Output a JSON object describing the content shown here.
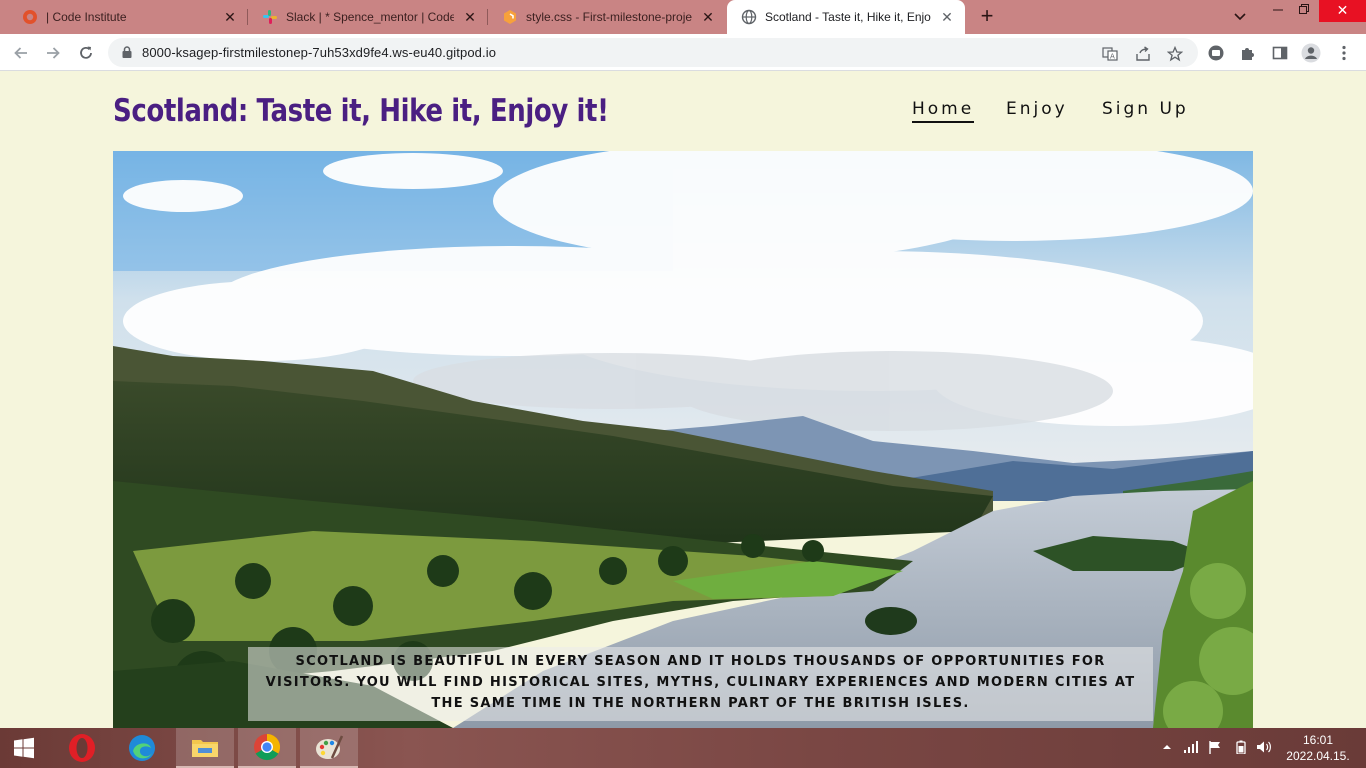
{
  "browser": {
    "tabs": [
      {
        "title": "| Code Institute",
        "icon": "code-institute-icon"
      },
      {
        "title": "Slack | * Spence_mentor | Code Ir",
        "icon": "slack-icon"
      },
      {
        "title": "style.css - First-milestone-project",
        "icon": "gitpod-icon"
      },
      {
        "title": "Scotland - Taste it, Hike it, Enjoy it",
        "icon": "globe-icon",
        "active": true
      }
    ],
    "new_tab_label": "+",
    "url": "8000-ksagep-firstmilestonep-7uh53xd9fe4.ws-eu40.gitpod.io"
  },
  "site": {
    "title": "Scotland: Taste it, Hike it, Enjoy it!",
    "nav": [
      "Home",
      "Enjoy",
      "Sign Up"
    ],
    "active_nav": "Home",
    "hero_caption": "Scotland is beautiful in every season and it holds thousands of opportunities for visitors. You will find historical sites, myths, culinary experiences and modern cities at the same time in the northern part of the British Isles.",
    "colors": {
      "title": "#4a1f82",
      "background": "#f5f5dc"
    }
  },
  "taskbar": {
    "apps": [
      "start-icon",
      "opera-icon",
      "edge-icon",
      "file-explorer-icon",
      "chrome-icon",
      "paint-icon"
    ],
    "time": "16:01",
    "date": "2022.04.15."
  }
}
